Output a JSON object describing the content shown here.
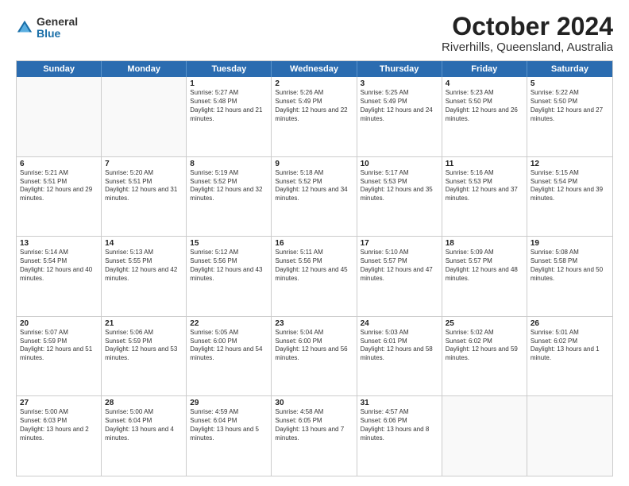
{
  "logo": {
    "general": "General",
    "blue": "Blue"
  },
  "header": {
    "month": "October 2024",
    "location": "Riverhills, Queensland, Australia"
  },
  "days": [
    "Sunday",
    "Monday",
    "Tuesday",
    "Wednesday",
    "Thursday",
    "Friday",
    "Saturday"
  ],
  "rows": [
    [
      {
        "day": "",
        "sunrise": "",
        "sunset": "",
        "daylight": ""
      },
      {
        "day": "",
        "sunrise": "",
        "sunset": "",
        "daylight": ""
      },
      {
        "day": "1",
        "sunrise": "Sunrise: 5:27 AM",
        "sunset": "Sunset: 5:48 PM",
        "daylight": "Daylight: 12 hours and 21 minutes."
      },
      {
        "day": "2",
        "sunrise": "Sunrise: 5:26 AM",
        "sunset": "Sunset: 5:49 PM",
        "daylight": "Daylight: 12 hours and 22 minutes."
      },
      {
        "day": "3",
        "sunrise": "Sunrise: 5:25 AM",
        "sunset": "Sunset: 5:49 PM",
        "daylight": "Daylight: 12 hours and 24 minutes."
      },
      {
        "day": "4",
        "sunrise": "Sunrise: 5:23 AM",
        "sunset": "Sunset: 5:50 PM",
        "daylight": "Daylight: 12 hours and 26 minutes."
      },
      {
        "day": "5",
        "sunrise": "Sunrise: 5:22 AM",
        "sunset": "Sunset: 5:50 PM",
        "daylight": "Daylight: 12 hours and 27 minutes."
      }
    ],
    [
      {
        "day": "6",
        "sunrise": "Sunrise: 5:21 AM",
        "sunset": "Sunset: 5:51 PM",
        "daylight": "Daylight: 12 hours and 29 minutes."
      },
      {
        "day": "7",
        "sunrise": "Sunrise: 5:20 AM",
        "sunset": "Sunset: 5:51 PM",
        "daylight": "Daylight: 12 hours and 31 minutes."
      },
      {
        "day": "8",
        "sunrise": "Sunrise: 5:19 AM",
        "sunset": "Sunset: 5:52 PM",
        "daylight": "Daylight: 12 hours and 32 minutes."
      },
      {
        "day": "9",
        "sunrise": "Sunrise: 5:18 AM",
        "sunset": "Sunset: 5:52 PM",
        "daylight": "Daylight: 12 hours and 34 minutes."
      },
      {
        "day": "10",
        "sunrise": "Sunrise: 5:17 AM",
        "sunset": "Sunset: 5:53 PM",
        "daylight": "Daylight: 12 hours and 35 minutes."
      },
      {
        "day": "11",
        "sunrise": "Sunrise: 5:16 AM",
        "sunset": "Sunset: 5:53 PM",
        "daylight": "Daylight: 12 hours and 37 minutes."
      },
      {
        "day": "12",
        "sunrise": "Sunrise: 5:15 AM",
        "sunset": "Sunset: 5:54 PM",
        "daylight": "Daylight: 12 hours and 39 minutes."
      }
    ],
    [
      {
        "day": "13",
        "sunrise": "Sunrise: 5:14 AM",
        "sunset": "Sunset: 5:54 PM",
        "daylight": "Daylight: 12 hours and 40 minutes."
      },
      {
        "day": "14",
        "sunrise": "Sunrise: 5:13 AM",
        "sunset": "Sunset: 5:55 PM",
        "daylight": "Daylight: 12 hours and 42 minutes."
      },
      {
        "day": "15",
        "sunrise": "Sunrise: 5:12 AM",
        "sunset": "Sunset: 5:56 PM",
        "daylight": "Daylight: 12 hours and 43 minutes."
      },
      {
        "day": "16",
        "sunrise": "Sunrise: 5:11 AM",
        "sunset": "Sunset: 5:56 PM",
        "daylight": "Daylight: 12 hours and 45 minutes."
      },
      {
        "day": "17",
        "sunrise": "Sunrise: 5:10 AM",
        "sunset": "Sunset: 5:57 PM",
        "daylight": "Daylight: 12 hours and 47 minutes."
      },
      {
        "day": "18",
        "sunrise": "Sunrise: 5:09 AM",
        "sunset": "Sunset: 5:57 PM",
        "daylight": "Daylight: 12 hours and 48 minutes."
      },
      {
        "day": "19",
        "sunrise": "Sunrise: 5:08 AM",
        "sunset": "Sunset: 5:58 PM",
        "daylight": "Daylight: 12 hours and 50 minutes."
      }
    ],
    [
      {
        "day": "20",
        "sunrise": "Sunrise: 5:07 AM",
        "sunset": "Sunset: 5:59 PM",
        "daylight": "Daylight: 12 hours and 51 minutes."
      },
      {
        "day": "21",
        "sunrise": "Sunrise: 5:06 AM",
        "sunset": "Sunset: 5:59 PM",
        "daylight": "Daylight: 12 hours and 53 minutes."
      },
      {
        "day": "22",
        "sunrise": "Sunrise: 5:05 AM",
        "sunset": "Sunset: 6:00 PM",
        "daylight": "Daylight: 12 hours and 54 minutes."
      },
      {
        "day": "23",
        "sunrise": "Sunrise: 5:04 AM",
        "sunset": "Sunset: 6:00 PM",
        "daylight": "Daylight: 12 hours and 56 minutes."
      },
      {
        "day": "24",
        "sunrise": "Sunrise: 5:03 AM",
        "sunset": "Sunset: 6:01 PM",
        "daylight": "Daylight: 12 hours and 58 minutes."
      },
      {
        "day": "25",
        "sunrise": "Sunrise: 5:02 AM",
        "sunset": "Sunset: 6:02 PM",
        "daylight": "Daylight: 12 hours and 59 minutes."
      },
      {
        "day": "26",
        "sunrise": "Sunrise: 5:01 AM",
        "sunset": "Sunset: 6:02 PM",
        "daylight": "Daylight: 13 hours and 1 minute."
      }
    ],
    [
      {
        "day": "27",
        "sunrise": "Sunrise: 5:00 AM",
        "sunset": "Sunset: 6:03 PM",
        "daylight": "Daylight: 13 hours and 2 minutes."
      },
      {
        "day": "28",
        "sunrise": "Sunrise: 5:00 AM",
        "sunset": "Sunset: 6:04 PM",
        "daylight": "Daylight: 13 hours and 4 minutes."
      },
      {
        "day": "29",
        "sunrise": "Sunrise: 4:59 AM",
        "sunset": "Sunset: 6:04 PM",
        "daylight": "Daylight: 13 hours and 5 minutes."
      },
      {
        "day": "30",
        "sunrise": "Sunrise: 4:58 AM",
        "sunset": "Sunset: 6:05 PM",
        "daylight": "Daylight: 13 hours and 7 minutes."
      },
      {
        "day": "31",
        "sunrise": "Sunrise: 4:57 AM",
        "sunset": "Sunset: 6:06 PM",
        "daylight": "Daylight: 13 hours and 8 minutes."
      },
      {
        "day": "",
        "sunrise": "",
        "sunset": "",
        "daylight": ""
      },
      {
        "day": "",
        "sunrise": "",
        "sunset": "",
        "daylight": ""
      }
    ]
  ]
}
